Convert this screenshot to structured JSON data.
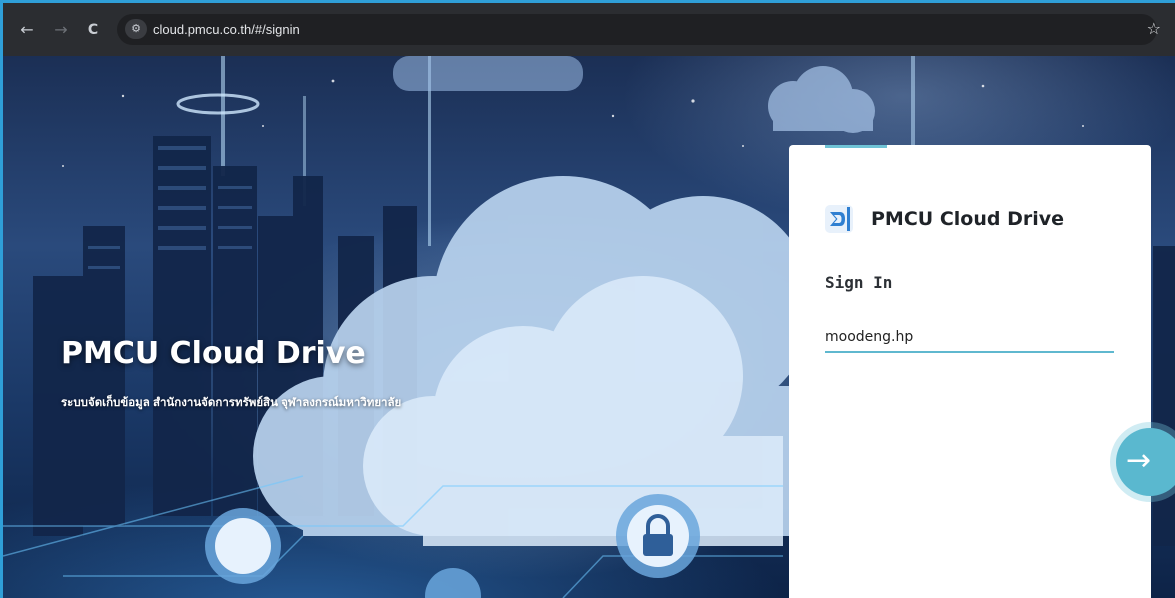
{
  "browser": {
    "back_icon": "←",
    "forward_icon": "→",
    "reload_icon": "C",
    "site_info_icon": "⚙",
    "url": "cloud.pmcu.co.th/#/signin",
    "bookmark_icon": "☆",
    "extension_icon": "Σ"
  },
  "hero": {
    "title": "PMCU Cloud Drive",
    "subtitle": "ระบบจัดเก็บข้อมูล สำนักงานจัดการทรัพย์สิน จุฬาลงกรณ์มหาวิทยาลัย"
  },
  "login": {
    "brand": "PMCU Cloud Drive",
    "heading": "Sign In",
    "username_value": "moodeng.hp",
    "submit_icon": "→"
  },
  "colors": {
    "accent": "#5ab8cf",
    "chrome": "#2b2d31",
    "frame": "#2f9fd8"
  }
}
